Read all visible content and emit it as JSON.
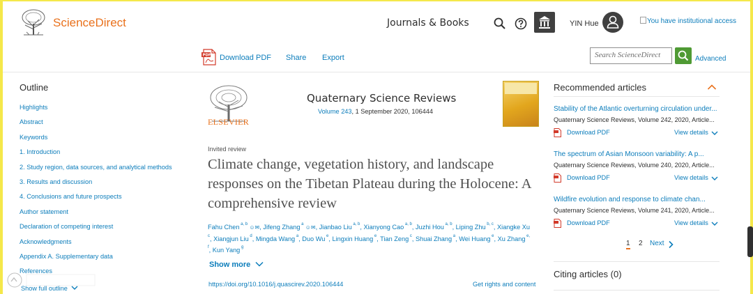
{
  "header": {
    "brand": "ScienceDirect",
    "journals_books": "Journals & Books",
    "user_name": "YIN Hue",
    "institution_alt": "You have institutional access"
  },
  "toolbar": {
    "download_pdf": "Download PDF",
    "share": "Share",
    "export": "Export",
    "search_placeholder": "Search ScienceDirect",
    "advanced": "Advanced"
  },
  "outline": {
    "title": "Outline",
    "items": [
      "Highlights",
      "Abstract",
      "Keywords",
      "1. Introduction",
      "2. Study region, data sources, and analytical methods",
      "3. Results and discussion",
      "4. Conclusions and future prospects",
      "Author statement",
      "Declaration of competing interest",
      "Acknowledgments",
      "Appendix A. Supplementary data",
      "References"
    ],
    "show_full": "Show full outline"
  },
  "article": {
    "publisher": "ELSEVIER",
    "journal": "Quaternary Science Reviews",
    "volume": "Volume 243",
    "date_id": ", 1 September 2020, 106444",
    "type": "Invited review",
    "title": "Climate change, vegetation history, and landscape responses on the Tibetan Plateau during the Holocene: A comprehensive review",
    "authors": [
      {
        "name": "Fahu Chen",
        "sup": "a, b"
      },
      {
        "name": "Jifeng Zhang",
        "sup": "a"
      },
      {
        "name": "Jianbao Liu",
        "sup": "a, b"
      },
      {
        "name": "Xianyong Cao",
        "sup": "a, b"
      },
      {
        "name": "Juzhi Hou",
        "sup": "a, b"
      },
      {
        "name": "Liping Zhu",
        "sup": "b, c"
      },
      {
        "name": "Xiangke Xu",
        "sup": "c"
      },
      {
        "name": "Xiangjun Liu",
        "sup": "d"
      },
      {
        "name": "Mingda Wang",
        "sup": "a"
      },
      {
        "name": "Duo Wu",
        "sup": "e"
      },
      {
        "name": "Lingxin Huang",
        "sup": "e"
      },
      {
        "name": "Tian Zeng",
        "sup": "c"
      },
      {
        "name": "Shuai Zhang",
        "sup": "a"
      },
      {
        "name": "Wei Huang",
        "sup": "e"
      },
      {
        "name": "Xu Zhang",
        "sup": "e, f"
      },
      {
        "name": "Kun Yang",
        "sup": "g"
      }
    ],
    "show_more": "Show more",
    "doi": "https://doi.org/10.1016/j.quascirev.2020.106444",
    "rights": "Get rights and content"
  },
  "recommended": {
    "title": "Recommended articles",
    "items": [
      {
        "title": "Stability of the Atlantic overturning circulation under...",
        "meta": "Quaternary Science Reviews, Volume 242, 2020, Article...",
        "download": "Download PDF",
        "details": "View details"
      },
      {
        "title": "The spectrum of Asian Monsoon variability: A p...",
        "meta": "Quaternary Science Reviews, Volume 240, 2020, Article...",
        "download": "Download PDF",
        "details": "View details"
      },
      {
        "title": "Wildfire evolution and response to climate chan...",
        "meta": "Quaternary Science Reviews, Volume 241, 2020, Article...",
        "download": "Download PDF",
        "details": "View details"
      }
    ],
    "page1": "1",
    "page2": "2",
    "next": "Next"
  },
  "citing": {
    "title": "Citing articles (0)"
  },
  "colors": {
    "brand_orange": "#e9711c",
    "link_blue": "#0c7dbb",
    "search_green": "#4f9a34",
    "frame_yellow": "#f5e84a"
  }
}
